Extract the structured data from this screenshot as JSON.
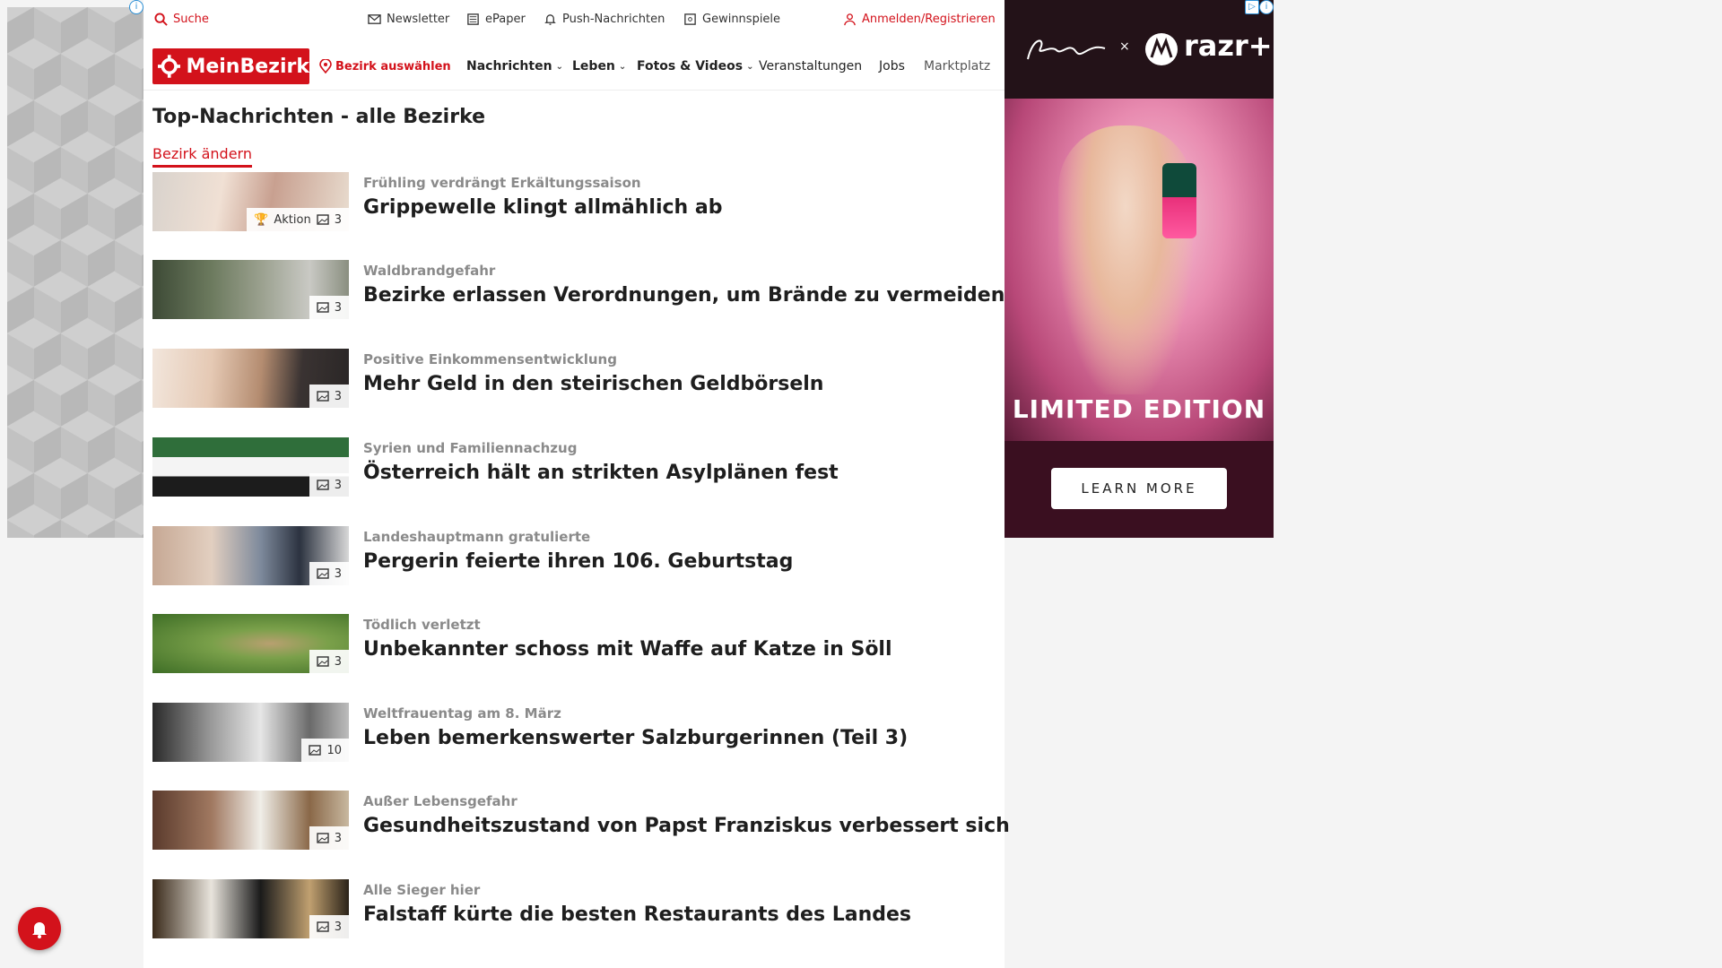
{
  "topbar": {
    "search": "Suche",
    "newsletter": "Newsletter",
    "epaper": "ePaper",
    "push": "Push-Nachrichten",
    "gewinnspiele": "Gewinnspiele",
    "login": "Anmelden/Registrieren"
  },
  "nav": {
    "logo": "MeinBezirk",
    "bezirk": "Bezirk auswählen",
    "items": [
      "Nachrichten",
      "Leben",
      "Fotos & Videos",
      "Veranstaltungen",
      "Jobs",
      "Marktplatz"
    ]
  },
  "page": {
    "title": "Top-Nachrichten - alle Bezirke",
    "change_link": "Bezirk ändern"
  },
  "articles": [
    {
      "kicker": "Frühling verdrängt Erkältungssaison",
      "headline": "Grippewelle klingt allmählich ab",
      "extra": "Aktion",
      "count": "3"
    },
    {
      "kicker": "Waldbrandgefahr",
      "headline": "Bezirke erlassen Verordnungen, um Brände zu vermeiden",
      "count": "3"
    },
    {
      "kicker": "Positive Einkommensentwicklung",
      "headline": "Mehr Geld in den steirischen Geldbörseln",
      "count": "3"
    },
    {
      "kicker": "Syrien und Familiennachzug",
      "headline": "Österreich hält an strikten Asylplänen fest",
      "count": "3"
    },
    {
      "kicker": "Landeshauptmann gratulierte",
      "headline": "Pergerin feierte ihren 106. Geburtstag",
      "count": "3"
    },
    {
      "kicker": "Tödlich verletzt",
      "headline": "Unbekannter schoss mit Waffe auf Katze in Söll",
      "count": "3"
    },
    {
      "kicker": "Weltfrauentag am 8. März",
      "headline": "Leben bemerkenswerter Salzburgerinnen (Teil 3)",
      "count": "10"
    },
    {
      "kicker": "Außer Lebensgefahr",
      "headline": "Gesundheitszustand von Papst Franziskus verbessert sich",
      "count": "3"
    },
    {
      "kicker": "Alle Sieger hier",
      "headline": "Falstaff kürte die besten Restaurants des Landes",
      "count": "3"
    }
  ],
  "ad": {
    "brand": "razr+",
    "tagline": "LIMITED EDITION",
    "cta": "LEARN MORE",
    "info": "i"
  },
  "colors": {
    "brand_red": "#d3121b"
  }
}
